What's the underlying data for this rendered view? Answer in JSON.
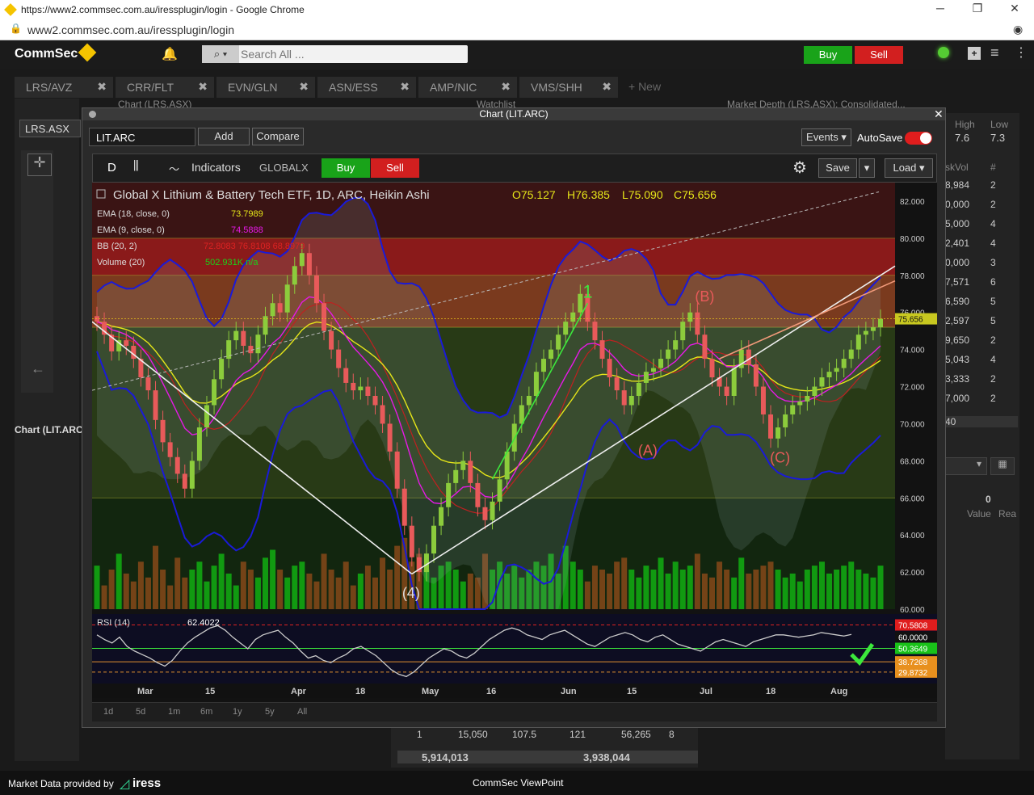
{
  "browser": {
    "title": "https://www2.commsec.com.au/iressplugin/login - Google Chrome",
    "url": "www2.commsec.com.au/iressplugin/login",
    "minimize": "─",
    "maximize": "❐",
    "close": "✕"
  },
  "app": {
    "logo": "CommSec",
    "search_placeholder": "Search All ...",
    "buy": "Buy",
    "sell": "Sell"
  },
  "tabs": [
    {
      "label": "LRS/AVZ"
    },
    {
      "label": "CRR/FLT"
    },
    {
      "label": "EVN/GLN"
    },
    {
      "label": "ASN/ESS"
    },
    {
      "label": "AMP/NIC"
    },
    {
      "label": "VMS/SHH"
    }
  ],
  "new_tab": "+ New",
  "background": {
    "chart_panel_title": "Chart (LRS.ASX)",
    "watchlist_title": "Watchlist",
    "market_depth_title": "Market Depth (LRS.ASX): Consolidated...",
    "symbol": "LRS.ASX",
    "left_label": "Chart (LIT.ARC",
    "high_label": "High",
    "low_label": "Low",
    "high": "7.6",
    "low": "7.3",
    "askvol_header": "skVol",
    "count_header": "#",
    "depth_rows": [
      {
        "vol": "8,984",
        "n": "2"
      },
      {
        "vol": "0,000",
        "n": "2"
      },
      {
        "vol": "5,000",
        "n": "4"
      },
      {
        "vol": "2,401",
        "n": "4"
      },
      {
        "vol": "0,000",
        "n": "3"
      },
      {
        "vol": "7,571",
        "n": "6"
      },
      {
        "vol": "6,590",
        "n": "5"
      },
      {
        "vol": "2,597",
        "n": "5"
      },
      {
        "vol": "9,650",
        "n": "2"
      },
      {
        "vol": "5,043",
        "n": "4"
      },
      {
        "vol": "3,333",
        "n": "2"
      },
      {
        "vol": "7,000",
        "n": "2"
      }
    ],
    "depth_footer": "40",
    "zero_value": "0",
    "value_label": "Value",
    "re_label": "Rea",
    "summary_row": [
      "1",
      "15,050",
      "107.5",
      "121",
      "56,265",
      "8"
    ],
    "totals": [
      "5,914,013",
      "3,938,044"
    ]
  },
  "modal": {
    "title": "Chart (LIT.ARC)",
    "symbol_value": "LIT.ARC",
    "add": "Add",
    "compare": "Compare",
    "events": "Events",
    "autosave": "AutoSave",
    "toolbar": {
      "period": "D",
      "indicators": "Indicators",
      "source": "GLOBALX",
      "buy": "Buy",
      "sell": "Sell",
      "save": "Save",
      "load": "Load"
    },
    "range_buttons": [
      "1d",
      "5d",
      "1m",
      "6m",
      "1y",
      "5y",
      "All"
    ]
  },
  "chart_data": {
    "type": "candlestick",
    "title": "Global X Lithium & Battery Tech ETF, 1D, ARC, Heikin Ashi",
    "ohlc": {
      "o": "O75.127",
      "h": "H76.385",
      "l": "L75.090",
      "c": "C75.656"
    },
    "legend": [
      {
        "label": "EMA (18, close, 0)",
        "value": "73.7989",
        "color": "#e6e619"
      },
      {
        "label": "EMA (9, close, 0)",
        "value": "74.5888",
        "color": "#e619e6"
      },
      {
        "label": "BB (20, 2)",
        "value": "72.8083  76.8108  68.8979",
        "color": "#d22"
      },
      {
        "label": "Volume (20)",
        "value": "502.931K  n/a",
        "color": "#19d219"
      }
    ],
    "y_ticks": [
      "82.000",
      "80.000",
      "78.000",
      "76.000",
      "74.000",
      "72.000",
      "70.000",
      "68.000",
      "66.000",
      "64.000",
      "62.000",
      "60.000"
    ],
    "ylim": [
      60,
      83
    ],
    "last_price": "75.656",
    "x_ticks": [
      "Mar",
      "15",
      "Apr",
      "18",
      "May",
      "16",
      "Jun",
      "15",
      "Jul",
      "18",
      "Aug"
    ],
    "close": [
      75.5,
      74.8,
      73.9,
      74.5,
      74.2,
      73.5,
      72.5,
      71.8,
      70.2,
      69.0,
      68.2,
      67.3,
      66.5,
      68.0,
      69.8,
      71.0,
      72.4,
      73.5,
      74.5,
      75.0,
      74.2,
      73.8,
      74.8,
      75.8,
      76.5,
      76.0,
      77.5,
      78.5,
      79.2,
      78.0,
      76.5,
      75.0,
      74.0,
      73.0,
      72.2,
      71.8,
      72.0,
      71.5,
      71.0,
      70.0,
      68.5,
      66.5,
      64.5,
      62.8,
      62.0,
      63.0,
      64.5,
      65.5,
      66.8,
      67.5,
      68.0,
      66.8,
      65.5,
      64.8,
      65.8,
      67.0,
      68.5,
      70.0,
      71.0,
      71.5,
      72.8,
      73.5,
      74.0,
      74.8,
      75.5,
      76.0,
      77.0,
      75.5,
      74.5,
      73.5,
      72.5,
      71.8,
      71.0,
      71.5,
      72.2,
      72.8,
      73.0,
      73.5,
      74.0,
      74.5,
      75.5,
      76.0,
      74.8,
      73.5,
      72.5,
      72.0,
      71.5,
      73.0,
      74.0,
      73.2,
      72.0,
      70.5,
      69.2,
      69.8,
      70.5,
      71.0,
      71.2,
      71.5,
      72.0,
      72.5,
      72.8,
      73.0,
      73.5,
      74.0,
      74.8,
      75.0,
      75.2,
      75.656
    ],
    "volume_max": 1,
    "volume": [
      0.55,
      0.3,
      0.5,
      0.7,
      0.45,
      0.35,
      0.6,
      0.4,
      0.8,
      0.5,
      0.3,
      0.65,
      0.4,
      0.5,
      0.6,
      0.35,
      0.55,
      0.7,
      0.45,
      0.3,
      0.6,
      0.5,
      0.4,
      0.65,
      0.75,
      0.5,
      0.4,
      0.55,
      0.6,
      0.45,
      0.35,
      0.7,
      0.5,
      0.4,
      0.6,
      0.3,
      0.45,
      0.55,
      0.4,
      0.65,
      0.5,
      0.8,
      0.9,
      0.6,
      0.7,
      0.5,
      0.4,
      0.55,
      0.6,
      0.5,
      0.35,
      0.45,
      0.4,
      0.7,
      0.5,
      0.6,
      0.45,
      0.55,
      0.4,
      0.5,
      0.6,
      0.55,
      0.7,
      0.45,
      0.8,
      0.6,
      0.5,
      0.35,
      0.55,
      0.5,
      0.45,
      0.6,
      0.65,
      0.5,
      0.4,
      0.55,
      0.5,
      0.65,
      0.45,
      0.6,
      0.5,
      0.55,
      0.7,
      0.45,
      0.4,
      0.6,
      0.5,
      0.4,
      0.65,
      0.45,
      0.5,
      0.55,
      0.6,
      0.5,
      0.4,
      0.45,
      0.35,
      0.5,
      0.55,
      0.6,
      0.45,
      0.5,
      0.55,
      0.6,
      0.5,
      0.45,
      0.4,
      0.55
    ],
    "rsi": {
      "label": "RSI (14)",
      "value": "62.4022",
      "levels": [
        "70.5808",
        "60.0000",
        "50.3649",
        "38.7268",
        "29.8732"
      ],
      "series": [
        62,
        58,
        55,
        60,
        52,
        48,
        45,
        42,
        38,
        35,
        40,
        48,
        55,
        60,
        64,
        68,
        70,
        66,
        60,
        55,
        50,
        58,
        62,
        64,
        66,
        60,
        55,
        48,
        42,
        44,
        40,
        38,
        42,
        45,
        50,
        52,
        48,
        44,
        38,
        32,
        28,
        26,
        30,
        36,
        42,
        46,
        50,
        48,
        44,
        42,
        46,
        52,
        58,
        62,
        66,
        68,
        66,
        62,
        60,
        58,
        62,
        64,
        66,
        62,
        58,
        54,
        52,
        56,
        60,
        62,
        64,
        62,
        58,
        56,
        60,
        62,
        58,
        54,
        52,
        50,
        48,
        52,
        56,
        58,
        56,
        54,
        52,
        56,
        58,
        60,
        62,
        62,
        61,
        60,
        61,
        62,
        64,
        63,
        62,
        61,
        62.4
      ]
    },
    "wave_labels": [
      "1",
      "(B)",
      "(A)",
      "(C)",
      "(4)"
    ]
  },
  "footer": {
    "left": "Market Data provided by",
    "brand": "iress",
    "center": "CommSec ViewPoint"
  }
}
